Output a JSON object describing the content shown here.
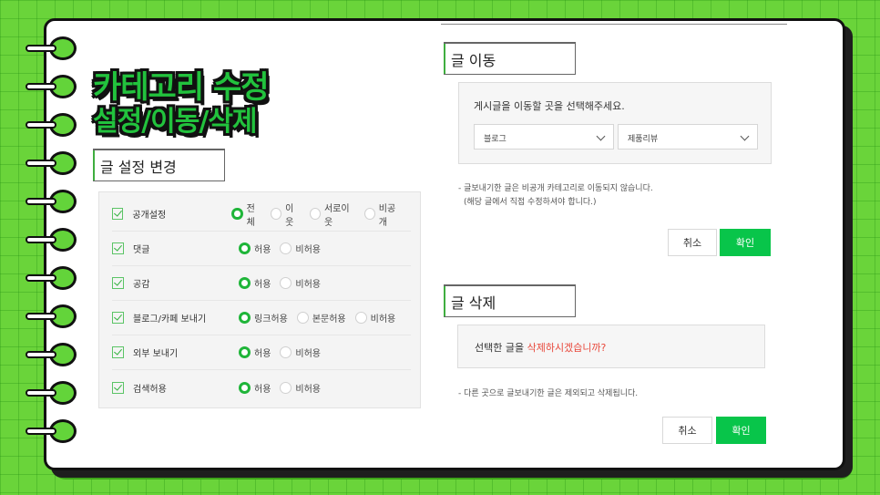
{
  "title": {
    "line1": "카테고리 수정",
    "line2": "설정/이동/삭제"
  },
  "settings": {
    "heading": "글 설정 변경",
    "rows": [
      {
        "label": "공개설정",
        "options": [
          "전체",
          "이웃",
          "서로이웃",
          "비공개"
        ],
        "selected": 0
      },
      {
        "label": "댓글",
        "options": [
          "허용",
          "비허용"
        ],
        "selected": 0
      },
      {
        "label": "공감",
        "options": [
          "허용",
          "비허용"
        ],
        "selected": 0
      },
      {
        "label": "블로그/카페 보내기",
        "options": [
          "링크허용",
          "본문허용",
          "비허용"
        ],
        "selected": 0
      },
      {
        "label": "외부 보내기",
        "options": [
          "허용",
          "비허용"
        ],
        "selected": 0
      },
      {
        "label": "검색허용",
        "options": [
          "허용",
          "비허용"
        ],
        "selected": 0
      }
    ]
  },
  "move": {
    "heading": "글 이동",
    "instruction": "게시글을 이동할 곳을 선택해주세요.",
    "blog_select": "블로그",
    "category_select": "제품리뷰",
    "note_line1": "- 글보내기한 글은 비공개 카테고리로 이동되지 않습니다.",
    "note_line2": "(해당 글에서 직접 수정하셔야 합니다.)",
    "cancel_label": "취소",
    "confirm_label": "확인"
  },
  "delete": {
    "heading": "글 삭제",
    "question_prefix": "선택한 글을 ",
    "question_highlight": "삭제하시겠습니까?",
    "note": "- 다른 곳으로 글보내기한 글은 제외되고 삭제됩니다.",
    "cancel_label": "취소",
    "confirm_label": "확인"
  },
  "colors": {
    "accent_green": "#08c54a",
    "background_green": "#6ad43a",
    "highlight_red": "#e8483b"
  }
}
